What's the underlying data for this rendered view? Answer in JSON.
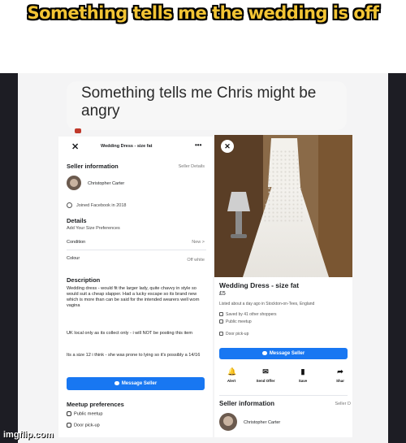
{
  "meme": {
    "caption": "Something tells me the wedding is off",
    "watermark": "imgflip.com"
  },
  "post": {
    "caption": "Something tells me Chris might be angry"
  },
  "listing_detail": {
    "close_glyph": "✕",
    "title": "Wedding Dress - size fat",
    "more_glyph": "•••",
    "seller_heading": "Seller information",
    "seller_details_link": "Seller Details",
    "seller_name": "Christopher Carter",
    "joined": "Joined Facebook in 2018",
    "details_heading": "Details",
    "size_pref": "Add Your Size Preferences",
    "condition_label": "Condition",
    "condition_value": "New",
    "colour_label": "Colour",
    "colour_value": "Off white",
    "description_heading": "Description",
    "description_p1": "Wedding dress - would fit the larger lady, quite chavvy in style so would suit a cheap slapper. Had a lucky escape so its brand new which is more than can be said for the intended wearers well worn vagina",
    "description_p2": "UK local only as its collect only - i will NOT be posting this item",
    "description_p3": "Its a size 12 i think - she was prone to lying so it's possibly a 14/16",
    "message_button": "Message Seller",
    "meetup_heading": "Meetup preferences",
    "meetup_public": "Public meetup",
    "meetup_door": "Door pick-up"
  },
  "listing_card": {
    "close_glyph": "✕",
    "title": "Wedding Dress - size fat",
    "price": "£5",
    "listed": "Listed about a day ago in Stockton-on-Tees, England",
    "saved": "Saved by 41 other shoppers",
    "public_meetup": "Public meetup",
    "door_pickup": "Door pick-up",
    "message_button": "Message Seller",
    "actions": [
      {
        "label": "Alert",
        "glyph": "🔔"
      },
      {
        "label": "Send Offer",
        "glyph": "✉"
      },
      {
        "label": "Save",
        "glyph": "▮"
      },
      {
        "label": "Shar",
        "glyph": "➦"
      }
    ],
    "seller_heading": "Seller information",
    "seller_details_link": "Seller D",
    "seller_name": "Christopher Carter"
  },
  "colors": {
    "caption_fill": "#f2c434",
    "fb_blue": "#1877f2"
  }
}
